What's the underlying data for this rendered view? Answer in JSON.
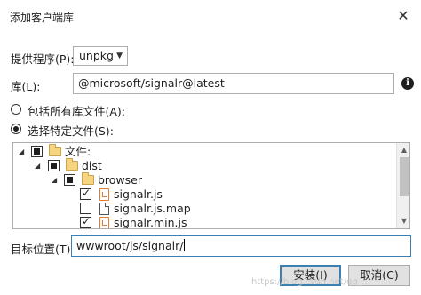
{
  "window": {
    "title": "添加客户端库",
    "close_glyph": "✕"
  },
  "provider": {
    "label": "提供程序(P):",
    "value": "unpkg",
    "chevron_icon": "chevron-down-icon"
  },
  "library": {
    "label": "库(L):",
    "value": "@microsoft/signalr@latest",
    "info_icon": "info-icon",
    "info_glyph": "i"
  },
  "options": {
    "include_all": {
      "label": "包括所有库文件(A):",
      "selected": false
    },
    "choose_specific": {
      "label": "选择特定文件(S):",
      "selected": true
    }
  },
  "tree": {
    "nodes": [
      {
        "label": "文件:",
        "type": "folder",
        "check": "partial",
        "expanded": true
      },
      {
        "label": "dist",
        "type": "folder",
        "check": "partial",
        "expanded": true
      },
      {
        "label": "browser",
        "type": "folder",
        "check": "partial",
        "expanded": true
      },
      {
        "label": "signalr.js",
        "type": "js-file",
        "check": "checked"
      },
      {
        "label": "signalr.js.map",
        "type": "map-file",
        "check": "unchecked"
      },
      {
        "label": "signalr.min.js",
        "type": "js-file",
        "check": "checked"
      }
    ]
  },
  "target": {
    "label": "目标位置(T):",
    "value": "wwwroot/js/signalr/"
  },
  "buttons": {
    "install": "安装(I)",
    "cancel": "取消(C)"
  },
  "watermark": "https://blog.csdn.net/qq_..."
}
